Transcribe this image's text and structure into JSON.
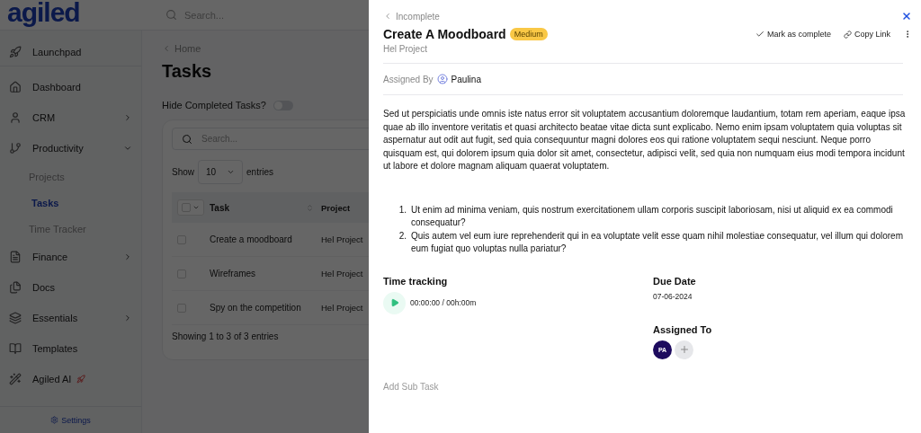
{
  "header": {
    "logo": "agiled",
    "search": {
      "placeholder": "Search..."
    }
  },
  "sidebar": {
    "items": [
      {
        "label": "Launchpad",
        "selected": false
      },
      {
        "label": "Dashboard",
        "selected": false
      },
      {
        "label": "CRM",
        "selected": false,
        "expanded": false
      },
      {
        "label": "Productivity",
        "selected": false,
        "expanded": true,
        "children": [
          {
            "label": "Projects",
            "selected": false
          },
          {
            "label": "Tasks",
            "selected": true
          },
          {
            "label": "Time Tracker",
            "selected": false
          }
        ]
      },
      {
        "label": "Finance",
        "selected": false,
        "expanded": false
      },
      {
        "label": "Docs",
        "selected": false
      },
      {
        "label": "Essentials",
        "selected": false,
        "expanded": false
      },
      {
        "label": "Templates",
        "selected": false
      },
      {
        "label": "Agiled AI",
        "selected": false
      }
    ],
    "settings": "Settings"
  },
  "main": {
    "breadcrumb": "Home",
    "title": "Tasks",
    "hide_completed": {
      "label": "Hide Completed Tasks?",
      "on": false
    },
    "table": {
      "search": {
        "placeholder": "Search..."
      },
      "show": "Show",
      "page_size": "10",
      "entries": "entries",
      "select_all": {
        "checked": false
      },
      "columns": [
        "Task",
        "Project"
      ],
      "rows": [
        {
          "task": "Create a moodboard",
          "project": "Hel Project",
          "checked": false
        },
        {
          "task": "Wireframes",
          "project": "Hel Project",
          "checked": false
        },
        {
          "task": "Spy on the competition",
          "project": "Hel Project",
          "checked": false
        }
      ],
      "footer": "Showing 1 to 3 of 3 entries"
    }
  },
  "drawer": {
    "back": "Incomplete",
    "title": "Create A Moodboard",
    "priority": "Medium",
    "project": "Hel Project",
    "actions": [
      "Mark as complete",
      "Copy Link"
    ],
    "assigned_by": {
      "label": "Assigned By",
      "name": "Paulina"
    },
    "description": "Sed ut perspiciatis unde omnis iste natus error sit voluptatem accusantium doloremque laudantium, totam rem aperiam, eaque ipsa quae ab illo inventore veritatis et quasi architecto beatae vitae dicta sunt explicabo. Nemo enim ipsam voluptatem quia voluptas sit aspernatur aut odit aut fugit, sed quia consequuntur magni dolores eos qui ratione voluptatem sequi nesciunt. Neque porro quisquam est, qui dolorem ipsum quia dolor sit amet, consectetur, adipisci velit, sed quia non numquam eius modi tempora incidunt ut labore et dolore magnam aliquam quaerat voluptatem.",
    "list": [
      {
        "marker": "1.",
        "text": "Ut enim ad minima veniam, quis nostrum exercitationem ullam corporis suscipit laboriosam, nisi ut aliquid ex ea commodi consequatur?"
      },
      {
        "marker": "2.",
        "text": "Quis autem vel eum iure reprehenderit qui in ea voluptate velit esse quam nihil molestiae consequatur, vel illum qui dolorem eum fugiat quo voluptas nulla pariatur?"
      }
    ],
    "time_tracking": {
      "label": "Time tracking",
      "time": "00:00:00 / 00h:00m"
    },
    "due_date": {
      "label": "Due Date",
      "value": "07-06-2024"
    },
    "assigned_to": {
      "label": "Assigned To",
      "assignees": [
        {
          "initials": "PA"
        }
      ]
    },
    "add_subtask": "Add Sub Task"
  }
}
